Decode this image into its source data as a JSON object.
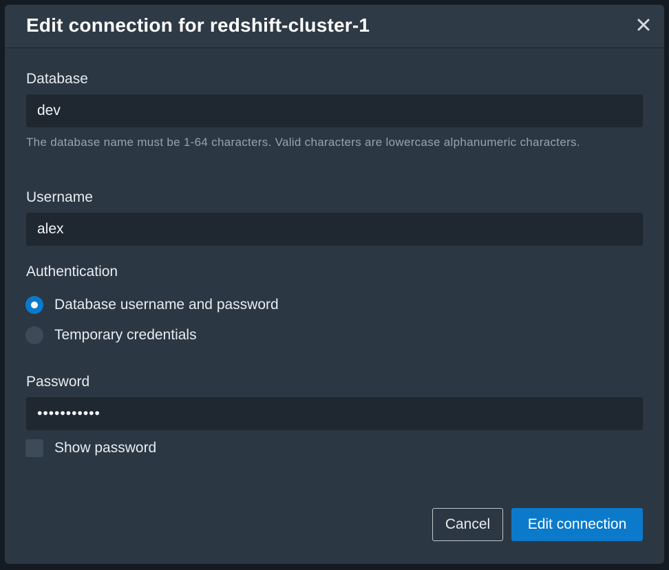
{
  "dialog": {
    "title": "Edit connection for redshift-cluster-1"
  },
  "database": {
    "label": "Database",
    "value": "dev",
    "hint": "The database name must be 1-64 characters. Valid characters are lowercase alphanumeric characters."
  },
  "username": {
    "label": "Username",
    "value": "alex"
  },
  "authentication": {
    "label": "Authentication",
    "options": [
      {
        "label": "Database username and password",
        "selected": true
      },
      {
        "label": "Temporary credentials",
        "selected": false
      }
    ]
  },
  "password": {
    "label": "Password",
    "masked_value": "•••••••••••",
    "show_password_label": "Show password",
    "show_password_checked": false
  },
  "footer": {
    "cancel_label": "Cancel",
    "submit_label": "Edit connection"
  },
  "colors": {
    "accent": "#0b7acb",
    "dialog_bg": "#2b3743",
    "input_bg": "#1f2830"
  }
}
